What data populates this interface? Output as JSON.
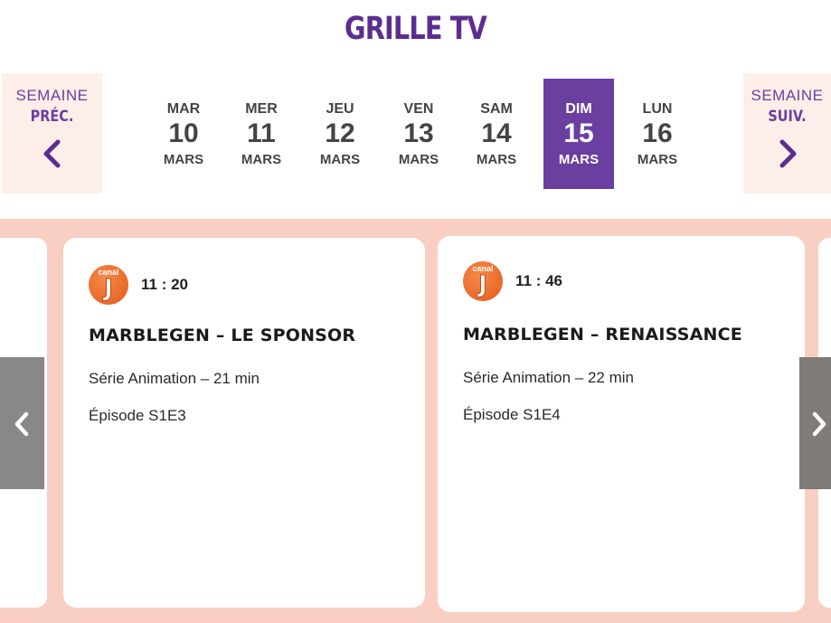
{
  "header": {
    "title": "GRILLE TV"
  },
  "week_nav": {
    "prev": {
      "line1": "SEMAINE",
      "line2": "PRÉC."
    },
    "next": {
      "line1": "SEMAINE",
      "line2": "SUIV."
    }
  },
  "days": [
    {
      "name": "MAR",
      "num": "10",
      "month": "MARS",
      "active": false
    },
    {
      "name": "MER",
      "num": "11",
      "month": "MARS",
      "active": false
    },
    {
      "name": "JEU",
      "num": "12",
      "month": "MARS",
      "active": false
    },
    {
      "name": "VEN",
      "num": "13",
      "month": "MARS",
      "active": false
    },
    {
      "name": "SAM",
      "num": "14",
      "month": "MARS",
      "active": false
    },
    {
      "name": "DIM",
      "num": "15",
      "month": "MARS",
      "active": true
    },
    {
      "name": "LUN",
      "num": "16",
      "month": "MARS",
      "active": false
    }
  ],
  "programs": [
    {
      "channel_logo": {
        "small": "canal",
        "big": "J"
      },
      "time": "11 : 20",
      "title": "MARBLEGEN – LE SPONSOR",
      "genre": "Série Animation – 21 min",
      "episode": "Épisode S1E3"
    },
    {
      "channel_logo": {
        "small": "canal",
        "big": "J"
      },
      "time": "11 : 46",
      "title": "MARBLEGEN – RENAISSANCE",
      "genre": "Série Animation – 22 min",
      "episode": "Épisode S1E4"
    }
  ],
  "colors": {
    "brand_purple": "#6a3fa0",
    "title_purple": "#5c2d91",
    "nav_bg": "#fdeee9",
    "strip_bg": "#f9cfc3",
    "logo_orange": "#e45a1a"
  },
  "icons": {
    "prev_week": "chevron-left-icon",
    "next_week": "chevron-right-icon",
    "carousel_prev": "chevron-left-icon",
    "carousel_next": "chevron-right-icon"
  }
}
